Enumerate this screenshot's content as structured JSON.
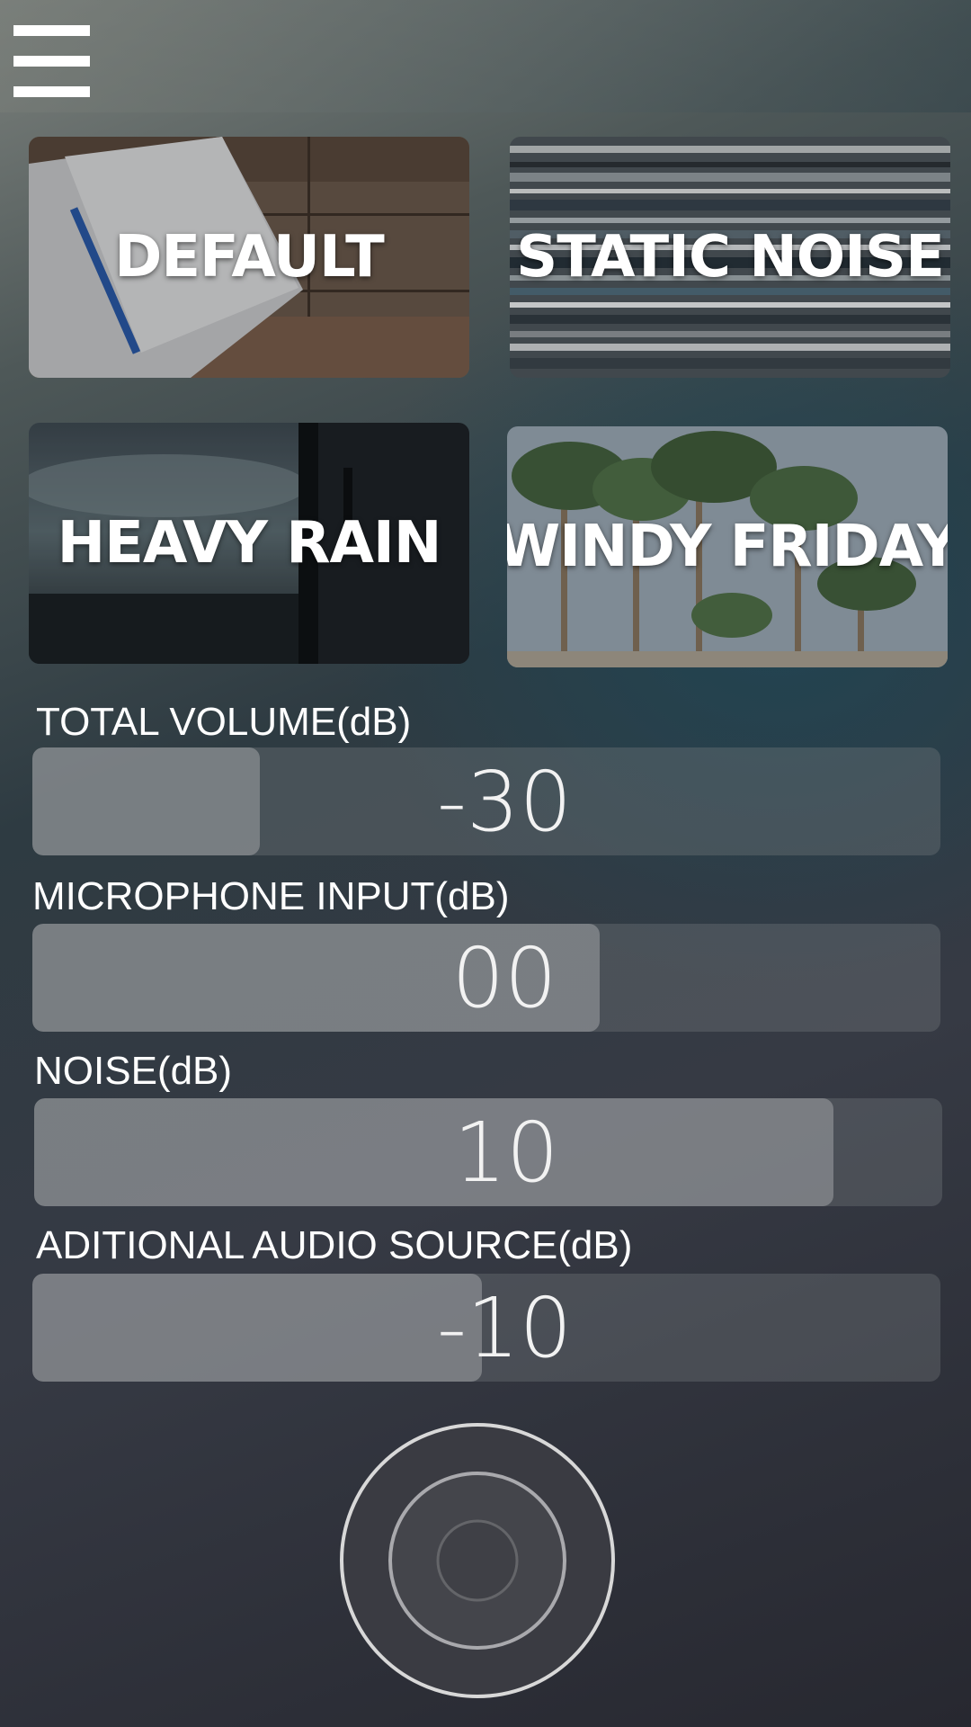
{
  "header": {
    "menu_icon": "hamburger-menu-icon"
  },
  "presets": [
    {
      "label": "DEFAULT",
      "image": "notebook-on-wood"
    },
    {
      "label": "STATIC NOISE",
      "image": "stacked-records"
    },
    {
      "label": "HEAVY RAIN",
      "image": "rainy-window"
    },
    {
      "label": "WINDY FRIDAY",
      "image": "windy-palm-trees"
    }
  ],
  "sliders": [
    {
      "label": "TOTAL VOLUME(dB)",
      "value": "-30",
      "level": 0.25
    },
    {
      "label": "MICROPHONE INPUT(dB)",
      "value": "00",
      "level": 0.625
    },
    {
      "label": "NOISE(dB)",
      "value": "10",
      "level": 0.88
    },
    {
      "label": "ADITIONAL  AUDIO SOURCE(dB)",
      "value": "-10",
      "level": 0.495
    }
  ],
  "record_button": {
    "icon": "record-ring-icon"
  }
}
